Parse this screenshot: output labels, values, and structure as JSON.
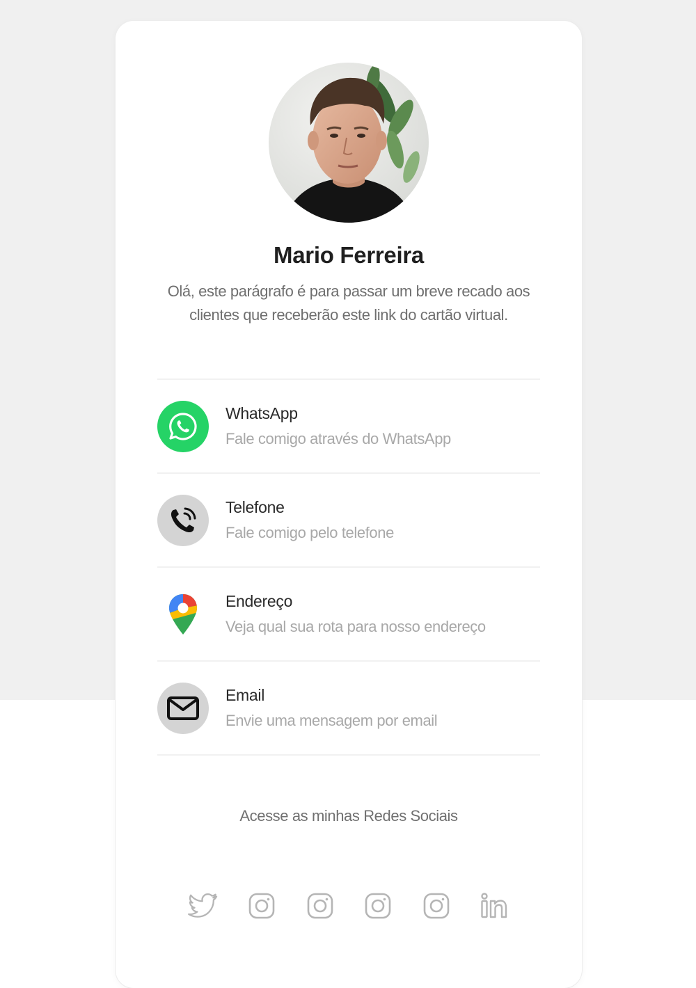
{
  "colors": {
    "whatsapp_green": "#25d366",
    "icon_gray": "#d4d4d4",
    "social_gray": "#b5b5b5"
  },
  "profile": {
    "avatar": "profile-photo",
    "name": "Mario Ferreira",
    "bio": "Olá, este parágrafo é para passar um breve recado aos clientes que receberão este link do cartão virtual."
  },
  "contacts": [
    {
      "icon": "whatsapp-icon",
      "title": "WhatsApp",
      "subtitle": "Fale comigo através do WhatsApp"
    },
    {
      "icon": "phone-icon",
      "title": "Telefone",
      "subtitle": "Fale comigo pelo telefone"
    },
    {
      "icon": "map-pin-icon",
      "title": "Endereço",
      "subtitle": "Veja qual sua rota para nosso endereço"
    },
    {
      "icon": "mail-icon",
      "title": "Email",
      "subtitle": "Envie uma mensagem por email"
    }
  ],
  "social": {
    "title": "Acesse as minhas Redes Sociais",
    "icons": [
      "twitter-icon",
      "instagram-icon",
      "instagram-icon",
      "instagram-icon",
      "instagram-icon",
      "linkedin-icon"
    ]
  }
}
